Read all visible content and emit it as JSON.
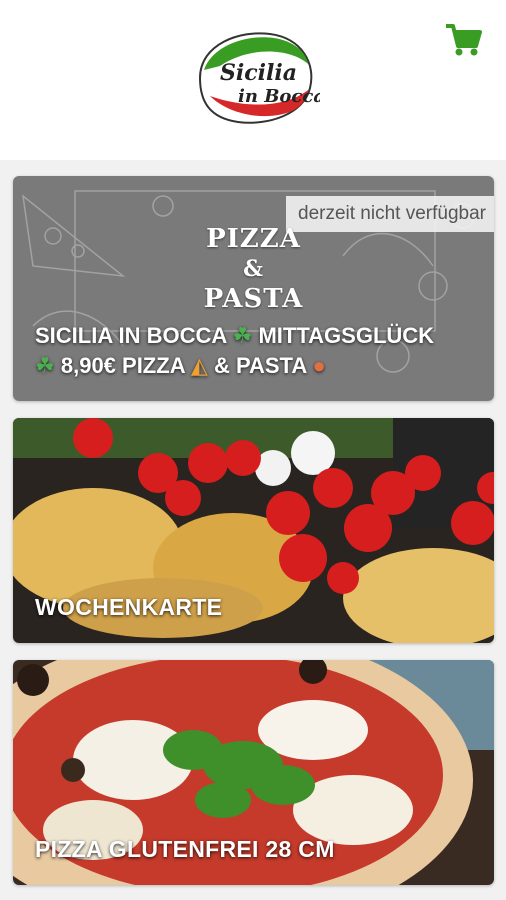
{
  "header": {
    "logo_text_line1": "Sicilia",
    "logo_text_line2": "in Bocca",
    "cart_icon": "shopping-cart-icon",
    "accent_color": "#3a9d23"
  },
  "cards": [
    {
      "badge": "derzeit nicht verfügbar",
      "heading_1": "PIZZA",
      "heading_2": "&",
      "heading_3": "PASTA",
      "line1_a": "SICILIA IN BOCCA",
      "line1_b": "MITTAGSGLÜCK",
      "line2_a": "8,90€ PIZZA",
      "line2_b": "& PASTA"
    },
    {
      "title": "WOCHENKARTE"
    },
    {
      "title": "PIZZA GLUTENFREI 28 CM"
    }
  ]
}
